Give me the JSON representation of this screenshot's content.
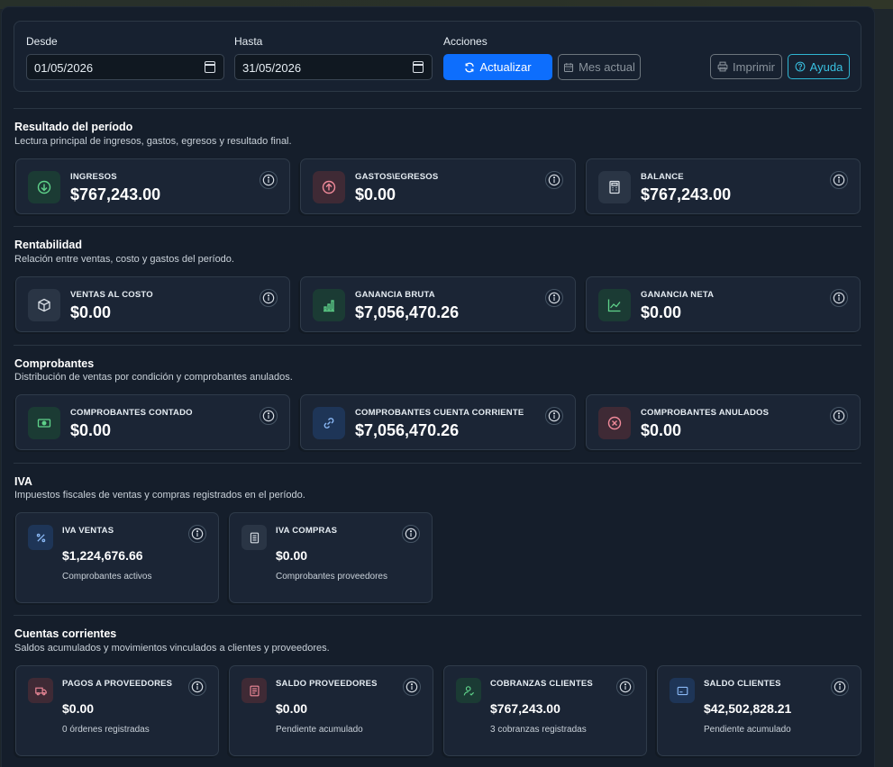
{
  "filters": {
    "desde_label": "Desde",
    "desde_value": "01/05/2026",
    "hasta_label": "Hasta",
    "hasta_value": "31/05/2026",
    "acciones_label": "Acciones",
    "actualizar": "Actualizar",
    "mes_actual": "Mes actual",
    "imprimir": "Imprimir",
    "ayuda": "Ayuda"
  },
  "sections": {
    "resultado": {
      "title": "Resultado del período",
      "subtitle": "Lectura principal de ingresos, gastos, egresos y resultado final.",
      "cards": [
        {
          "title": "INGRESOS",
          "value": "$767,243.00"
        },
        {
          "title": "GASTOS\\EGRESOS",
          "value": "$0.00"
        },
        {
          "title": "BALANCE",
          "value": "$767,243.00"
        }
      ]
    },
    "rentabilidad": {
      "title": "Rentabilidad",
      "subtitle": "Relación entre ventas, costo y gastos del período.",
      "cards": [
        {
          "title": "VENTAS AL COSTO",
          "value": "$0.00"
        },
        {
          "title": "GANANCIA BRUTA",
          "value": "$7,056,470.26"
        },
        {
          "title": "GANANCIA NETA",
          "value": "$0.00"
        }
      ]
    },
    "comprobantes": {
      "title": "Comprobantes",
      "subtitle": "Distribución de ventas por condición y comprobantes anulados.",
      "cards": [
        {
          "title": "COMPROBANTES CONTADO",
          "value": "$0.00"
        },
        {
          "title": "COMPROBANTES CUENTA CORRIENTE",
          "value": "$7,056,470.26"
        },
        {
          "title": "COMPROBANTES ANULADOS",
          "value": "$0.00"
        }
      ]
    },
    "iva": {
      "title": "IVA",
      "subtitle": "Impuestos fiscales de ventas y compras registrados en el período.",
      "cards": [
        {
          "title": "IVA VENTAS",
          "value": "$1,224,676.66",
          "sub": "Comprobantes activos"
        },
        {
          "title": "IVA COMPRAS",
          "value": "$0.00",
          "sub": "Comprobantes proveedores"
        }
      ]
    },
    "cuentas": {
      "title": "Cuentas corrientes",
      "subtitle": "Saldos acumulados y movimientos vinculados a clientes y proveedores.",
      "cards": [
        {
          "title": "PAGOS A PROVEEDORES",
          "value": "$0.00",
          "sub": "0 órdenes registradas"
        },
        {
          "title": "SALDO PROVEEDORES",
          "value": "$0.00",
          "sub": "Pendiente acumulado"
        },
        {
          "title": "COBRANZAS CLIENTES",
          "value": "$767,243.00",
          "sub": "3 cobranzas registradas"
        },
        {
          "title": "SALDO CLIENTES",
          "value": "$42,502,828.21",
          "sub": "Pendiente acumulado"
        }
      ]
    }
  }
}
